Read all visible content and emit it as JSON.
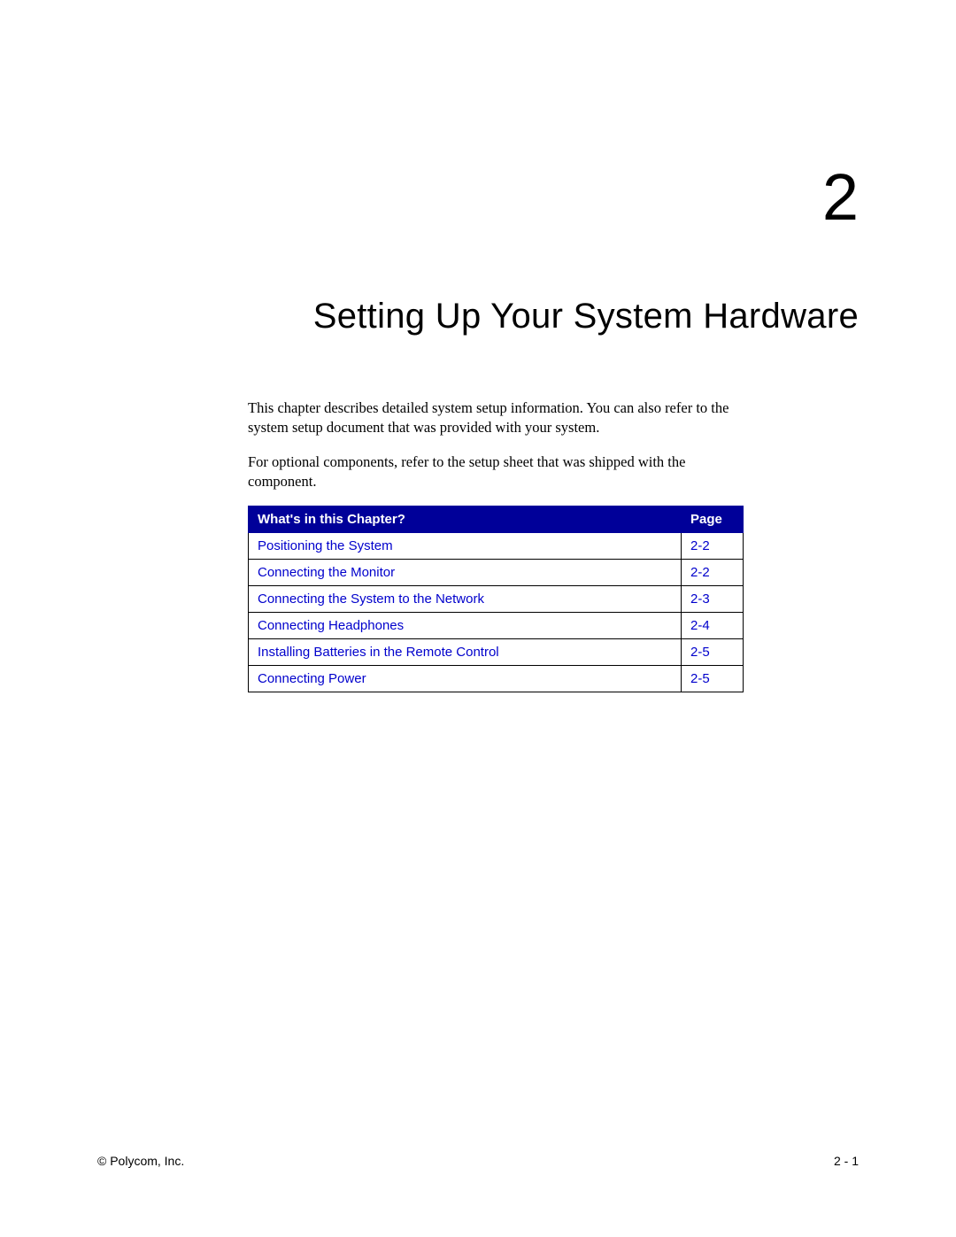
{
  "chapter": {
    "number": "2",
    "title": "Setting Up Your System Hardware"
  },
  "paragraphs": [
    "This chapter describes detailed system setup information. You can also refer to the system setup document that was provided with your system.",
    "For optional components, refer to the setup sheet that was shipped with the component."
  ],
  "toc": {
    "header_title": "What's in this Chapter?",
    "header_page": "Page",
    "rows": [
      {
        "title": "Positioning the System",
        "page": "2-2"
      },
      {
        "title": "Connecting the Monitor",
        "page": "2-2"
      },
      {
        "title": "Connecting the System to the Network",
        "page": "2-3"
      },
      {
        "title": "Connecting Headphones",
        "page": "2-4"
      },
      {
        "title": "Installing Batteries in the Remote Control",
        "page": "2-5"
      },
      {
        "title": "Connecting Power",
        "page": "2-5"
      }
    ]
  },
  "footer": {
    "copyright": "© Polycom, Inc.",
    "page_number": "2 - 1"
  }
}
